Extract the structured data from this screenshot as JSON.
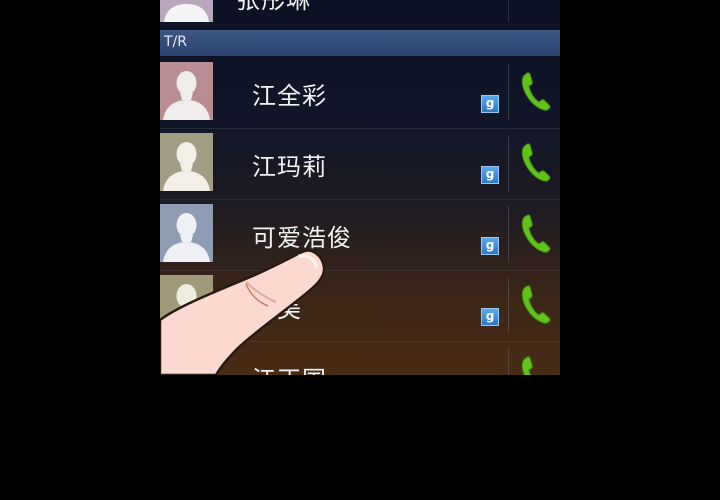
{
  "section_header": "T/R",
  "contacts": [
    {
      "name": "张彤琳",
      "avatar_bg": "#b9a6bd",
      "has_google_badge": false
    },
    {
      "name": "江全彩",
      "avatar_bg": "#b88d94",
      "has_google_badge": true
    },
    {
      "name": "江玛莉",
      "avatar_bg": "#a39e83",
      "has_google_badge": true
    },
    {
      "name": "可爱浩俊",
      "avatar_bg": "#8f9cb4",
      "has_google_badge": true
    },
    {
      "name": "江美",
      "avatar_bg": "#a09a78",
      "has_google_badge": true
    },
    {
      "name": "江正国",
      "avatar_bg": "#8a8e9a",
      "has_google_badge": false
    }
  ],
  "badge_label": "g",
  "icons": {
    "call": "phone-handset-icon",
    "badge": "google-contact-icon",
    "avatar": "default-person-avatar-icon"
  },
  "colors": {
    "call_icon": "#62c21c",
    "section_bar": "#34507a",
    "badge": "#3a88d8",
    "finger_skin": "#fbd9d0"
  }
}
